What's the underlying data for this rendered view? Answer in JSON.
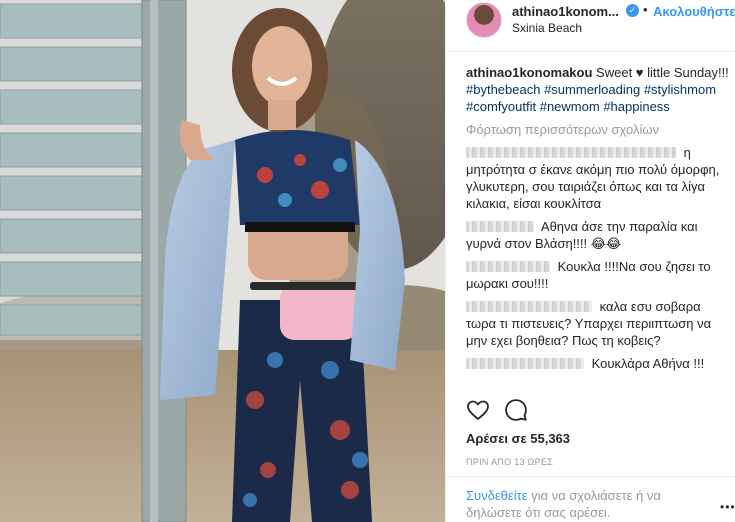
{
  "post": {
    "username": "athinao1konom...",
    "follow_separator": "•",
    "follow_label": "Ακολουθήστε",
    "location": "Sxinia Beach",
    "caption": {
      "user": "athinao1konomakou",
      "text": "Sweet ♥ little Sunday!!!",
      "hashtags": [
        "#bythebeach",
        "#summerloading",
        "#stylishmom",
        "#comfyoutfit",
        "#newmom",
        "#happiness"
      ]
    },
    "load_more": "Φόρτωση περισσότερων σχολίων",
    "comments": [
      {
        "text": "η μητρότητα σ έκανε ακόμη πιο πολύ όμορφη, γλυκυτερη, σου ταιριάζει όπως και τα λίγα κιλακια, είσαι κουκλίτσα"
      },
      {
        "text": "Αθηνα άσε την παραλία και γυρνά στον Βλάση!!!! 😂😂"
      },
      {
        "text": "Κουκλα !!!!Να σου ζησει το μωρακι σου!!!!"
      },
      {
        "text": "καλα εσυ σοβαρα τωρα τι πιστευεις? Υπαρχει περιιπτωση να μην εχει βοηθεια? Πως τη κοβεις?"
      },
      {
        "text": "Κουκλάρα Αθήνα !!!"
      }
    ],
    "likes": "Αρέσει σε 55,363",
    "time": "ΠΡΙΝ ΑΠΟ 13 ΩΡΕΣ",
    "login_link": "Συνδεθείτε",
    "login_rest": " για να σχολιάσετε ή να δηλώσετε ότι σας αρέσει.",
    "more_label": "•••"
  },
  "colors": {
    "accent": "#3897f0",
    "hashtag": "#003569",
    "muted": "#999999",
    "text": "#262626"
  },
  "icons": {
    "like": "heart-outline-icon",
    "comment": "speech-bubble-icon",
    "verified": "verified-badge-icon"
  }
}
